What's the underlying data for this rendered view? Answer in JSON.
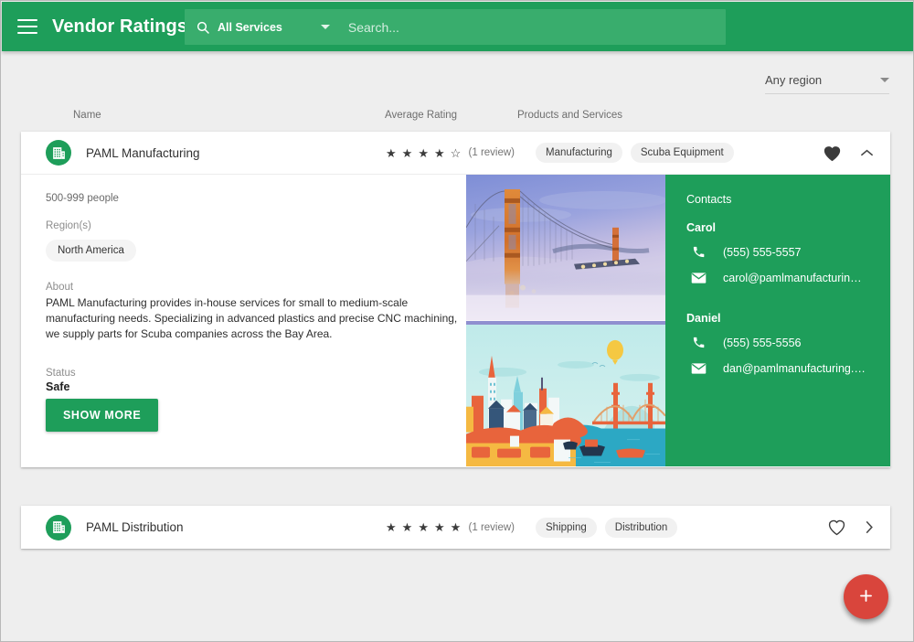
{
  "appbar": {
    "menu_icon": "hamburger-menu-icon",
    "title": "Vendor Ratings",
    "search_icon": "search-icon",
    "service_filter": "All Services",
    "service_caret_icon": "chevron-down-icon",
    "search_placeholder": "Search...",
    "search_value": "",
    "bg_color": "#1e9e5a",
    "search_bg_color": "#39ad6d"
  },
  "filters": {
    "region": "Any region",
    "region_caret_icon": "chevron-down-icon"
  },
  "columns": {
    "name": "Name",
    "rating": "Average Rating",
    "products": "Products and Services"
  },
  "vendors": [
    {
      "icon": "building-icon",
      "name": "PAML Manufacturing",
      "stars_filled": 4,
      "stars_total": 5,
      "review_count": "(1 review)",
      "chips": [
        "Manufacturing",
        "Scuba Equipment"
      ],
      "favorite": true,
      "favorite_icon": "heart-filled-icon",
      "expand_icon": "chevron-up-icon",
      "expanded": true,
      "details": {
        "people": "500-999 people",
        "regions_label": "Region(s)",
        "regions": [
          "North America"
        ],
        "about_label": "About",
        "about": "PAML Manufacturing provides in-house services for small to medium-scale manufacturing needs. Specializing in advanced plastics and precise CNC machining, we supply parts for Scuba companies across the Bay Area.",
        "status_label": "Status",
        "status_value": "Safe",
        "show_more": "SHOW MORE"
      },
      "photos": [
        {
          "name": "golden-gate-bridge-fog-photo",
          "alt": "Golden Gate Bridge in fog at dusk"
        },
        {
          "name": "san-francisco-skyline-illustration",
          "alt": "Illustrated San Francisco skyline with Golden Gate Bridge"
        }
      ],
      "contacts": {
        "title": "Contacts",
        "people": [
          {
            "name": "Carol",
            "phone_icon": "phone-icon",
            "phone": "(555) 555-5557",
            "email_icon": "email-icon",
            "email": "carol@pamlmanufacturin…"
          },
          {
            "name": "Daniel",
            "phone_icon": "phone-icon",
            "phone": "(555) 555-5556",
            "email_icon": "email-icon",
            "email": "dan@pamlmanufacturing.…"
          }
        ]
      }
    },
    {
      "icon": "building-icon",
      "name": "PAML Distribution",
      "stars_filled": 5,
      "stars_total": 5,
      "review_count": "(1 review)",
      "chips": [
        "Shipping",
        "Distribution"
      ],
      "favorite": false,
      "favorite_icon": "heart-outline-icon",
      "expand_icon": "chevron-right-icon",
      "expanded": false
    }
  ],
  "fab": {
    "icon": "plus-icon",
    "label": "Add vendor",
    "color": "#d9453c"
  }
}
